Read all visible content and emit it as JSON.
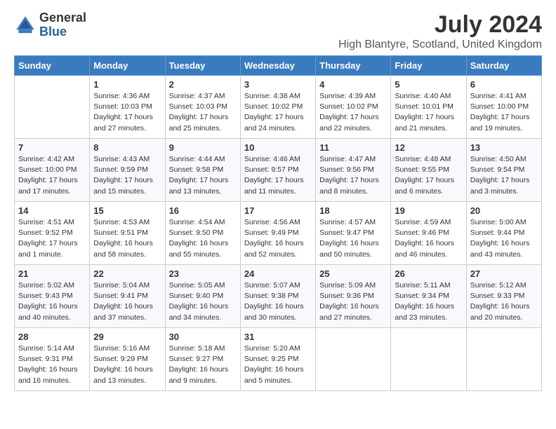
{
  "logo": {
    "general": "General",
    "blue": "Blue"
  },
  "title": "July 2024",
  "location": "High Blantyre, Scotland, United Kingdom",
  "days_of_week": [
    "Sunday",
    "Monday",
    "Tuesday",
    "Wednesday",
    "Thursday",
    "Friday",
    "Saturday"
  ],
  "weeks": [
    [
      {
        "day": "",
        "info": ""
      },
      {
        "day": "1",
        "info": "Sunrise: 4:36 AM\nSunset: 10:03 PM\nDaylight: 17 hours\nand 27 minutes."
      },
      {
        "day": "2",
        "info": "Sunrise: 4:37 AM\nSunset: 10:03 PM\nDaylight: 17 hours\nand 25 minutes."
      },
      {
        "day": "3",
        "info": "Sunrise: 4:38 AM\nSunset: 10:02 PM\nDaylight: 17 hours\nand 24 minutes."
      },
      {
        "day": "4",
        "info": "Sunrise: 4:39 AM\nSunset: 10:02 PM\nDaylight: 17 hours\nand 22 minutes."
      },
      {
        "day": "5",
        "info": "Sunrise: 4:40 AM\nSunset: 10:01 PM\nDaylight: 17 hours\nand 21 minutes."
      },
      {
        "day": "6",
        "info": "Sunrise: 4:41 AM\nSunset: 10:00 PM\nDaylight: 17 hours\nand 19 minutes."
      }
    ],
    [
      {
        "day": "7",
        "info": "Sunrise: 4:42 AM\nSunset: 10:00 PM\nDaylight: 17 hours\nand 17 minutes."
      },
      {
        "day": "8",
        "info": "Sunrise: 4:43 AM\nSunset: 9:59 PM\nDaylight: 17 hours\nand 15 minutes."
      },
      {
        "day": "9",
        "info": "Sunrise: 4:44 AM\nSunset: 9:58 PM\nDaylight: 17 hours\nand 13 minutes."
      },
      {
        "day": "10",
        "info": "Sunrise: 4:46 AM\nSunset: 9:57 PM\nDaylight: 17 hours\nand 11 minutes."
      },
      {
        "day": "11",
        "info": "Sunrise: 4:47 AM\nSunset: 9:56 PM\nDaylight: 17 hours\nand 8 minutes."
      },
      {
        "day": "12",
        "info": "Sunrise: 4:48 AM\nSunset: 9:55 PM\nDaylight: 17 hours\nand 6 minutes."
      },
      {
        "day": "13",
        "info": "Sunrise: 4:50 AM\nSunset: 9:54 PM\nDaylight: 17 hours\nand 3 minutes."
      }
    ],
    [
      {
        "day": "14",
        "info": "Sunrise: 4:51 AM\nSunset: 9:52 PM\nDaylight: 17 hours\nand 1 minute."
      },
      {
        "day": "15",
        "info": "Sunrise: 4:53 AM\nSunset: 9:51 PM\nDaylight: 16 hours\nand 58 minutes."
      },
      {
        "day": "16",
        "info": "Sunrise: 4:54 AM\nSunset: 9:50 PM\nDaylight: 16 hours\nand 55 minutes."
      },
      {
        "day": "17",
        "info": "Sunrise: 4:56 AM\nSunset: 9:49 PM\nDaylight: 16 hours\nand 52 minutes."
      },
      {
        "day": "18",
        "info": "Sunrise: 4:57 AM\nSunset: 9:47 PM\nDaylight: 16 hours\nand 50 minutes."
      },
      {
        "day": "19",
        "info": "Sunrise: 4:59 AM\nSunset: 9:46 PM\nDaylight: 16 hours\nand 46 minutes."
      },
      {
        "day": "20",
        "info": "Sunrise: 5:00 AM\nSunset: 9:44 PM\nDaylight: 16 hours\nand 43 minutes."
      }
    ],
    [
      {
        "day": "21",
        "info": "Sunrise: 5:02 AM\nSunset: 9:43 PM\nDaylight: 16 hours\nand 40 minutes."
      },
      {
        "day": "22",
        "info": "Sunrise: 5:04 AM\nSunset: 9:41 PM\nDaylight: 16 hours\nand 37 minutes."
      },
      {
        "day": "23",
        "info": "Sunrise: 5:05 AM\nSunset: 9:40 PM\nDaylight: 16 hours\nand 34 minutes."
      },
      {
        "day": "24",
        "info": "Sunrise: 5:07 AM\nSunset: 9:38 PM\nDaylight: 16 hours\nand 30 minutes."
      },
      {
        "day": "25",
        "info": "Sunrise: 5:09 AM\nSunset: 9:36 PM\nDaylight: 16 hours\nand 27 minutes."
      },
      {
        "day": "26",
        "info": "Sunrise: 5:11 AM\nSunset: 9:34 PM\nDaylight: 16 hours\nand 23 minutes."
      },
      {
        "day": "27",
        "info": "Sunrise: 5:12 AM\nSunset: 9:33 PM\nDaylight: 16 hours\nand 20 minutes."
      }
    ],
    [
      {
        "day": "28",
        "info": "Sunrise: 5:14 AM\nSunset: 9:31 PM\nDaylight: 16 hours\nand 16 minutes."
      },
      {
        "day": "29",
        "info": "Sunrise: 5:16 AM\nSunset: 9:29 PM\nDaylight: 16 hours\nand 13 minutes."
      },
      {
        "day": "30",
        "info": "Sunrise: 5:18 AM\nSunset: 9:27 PM\nDaylight: 16 hours\nand 9 minutes."
      },
      {
        "day": "31",
        "info": "Sunrise: 5:20 AM\nSunset: 9:25 PM\nDaylight: 16 hours\nand 5 minutes."
      },
      {
        "day": "",
        "info": ""
      },
      {
        "day": "",
        "info": ""
      },
      {
        "day": "",
        "info": ""
      }
    ]
  ]
}
